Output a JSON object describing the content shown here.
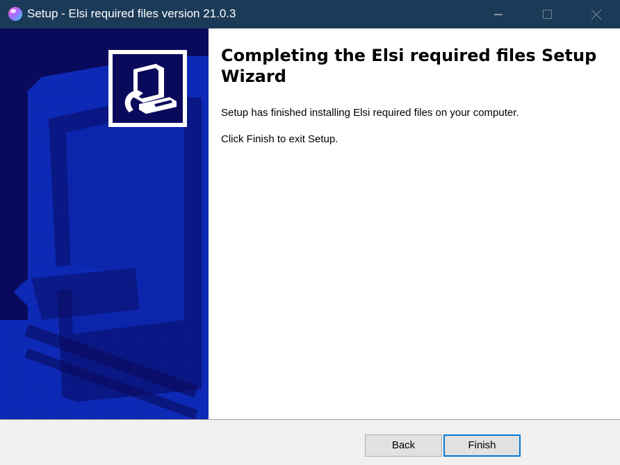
{
  "window": {
    "title": "Setup - Elsi required files version 21.0.3",
    "controls": [
      "minimize-icon",
      "maximize-icon",
      "close-icon"
    ]
  },
  "banner": {
    "logo_icon": "installer-computer-icon",
    "background_color": "#0a0a5c"
  },
  "content": {
    "heading": "Completing the Elsi required files Setup Wizard",
    "paragraph_1": "Setup has finished installing Elsi required files on your computer.",
    "paragraph_2": "Click Finish to exit Setup."
  },
  "footer": {
    "back_label": "Back",
    "finish_label": "Finish"
  },
  "colors": {
    "titlebar": "#1b3a58",
    "focus_border": "#0078d7"
  }
}
